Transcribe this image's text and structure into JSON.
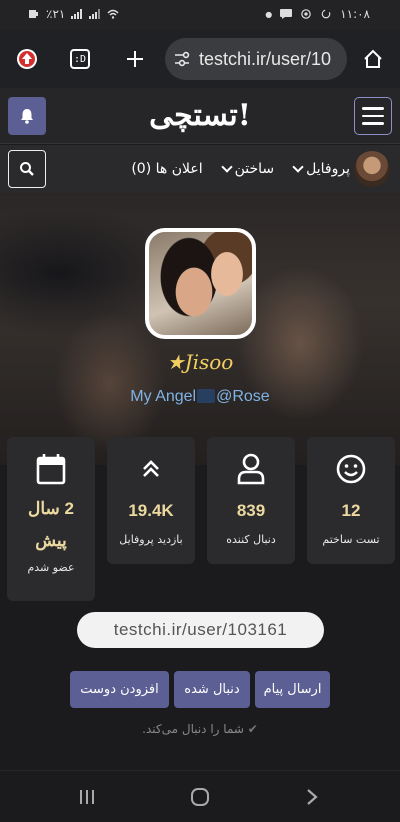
{
  "statusbar": {
    "time": "۱۱:۰۸",
    "battery": "٪۲۱"
  },
  "browser": {
    "url": "testchi.ir/user/10",
    "tabs_label": ":D"
  },
  "site": {
    "logo": "تستچی!"
  },
  "nav": {
    "items": [
      {
        "label": "پروفایل"
      },
      {
        "label": "ساختن"
      },
      {
        "label": "اعلان ها (0)"
      }
    ]
  },
  "profile": {
    "username": "★Jisoo",
    "bio_left": "My Angel",
    "bio_right": "@Rose"
  },
  "stats": [
    {
      "icon": "smile-icon",
      "value": "12",
      "label": "تست ساختم"
    },
    {
      "icon": "user-icon",
      "value": "839",
      "label": "دنبال کننده"
    },
    {
      "icon": "double-chevron-up-icon",
      "value": "19.4K",
      "label": "بازدید پروفایل"
    },
    {
      "icon": "calendar-icon",
      "value": "2 سال پیش",
      "label": "عضو شدم"
    }
  ],
  "profile_url": "testchi.ir/user/103161",
  "actions": {
    "message": "ارسال پیام",
    "followed": "دنبال شده",
    "add_friend": "افزودن دوست"
  },
  "follow_note": "شما را دنبال می‌کند.",
  "colors": {
    "accent": "#5c5f93",
    "value": "#ecd9a0",
    "username": "#f0d060",
    "bio": "#7fb3e6"
  }
}
